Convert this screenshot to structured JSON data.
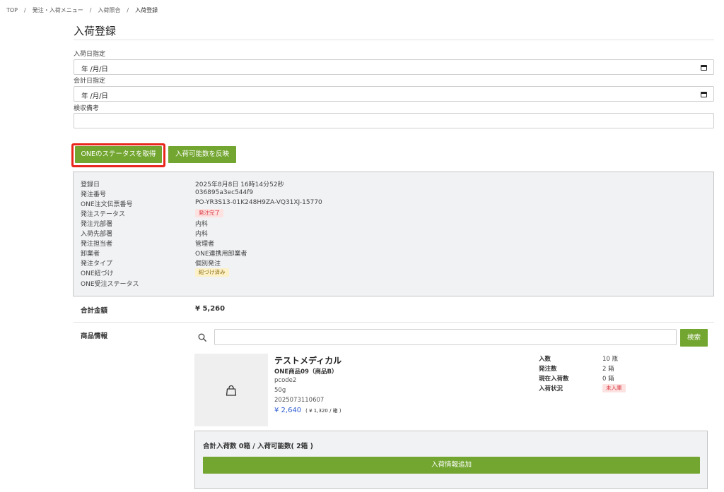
{
  "breadcrumb": {
    "items": [
      "TOP",
      "発注・入荷メニュー",
      "入荷照合"
    ],
    "current": "入荷登録",
    "separator": "/"
  },
  "page": {
    "title": "入荷登録"
  },
  "form": {
    "arrival_date_label": "入荷日指定",
    "arrival_date_value": "年 /月/日",
    "accounting_date_label": "会計日指定",
    "accounting_date_value": "年 /月/日",
    "inspection_note_label": "検収備考",
    "inspection_note_value": ""
  },
  "actions": {
    "get_one_status_label": "ONEのステータスを取得",
    "reflect_available_label": "入荷可能数を反映"
  },
  "info": {
    "registered_date_label": "登録日",
    "registered_date_value": "2025年8月8日 16時14分52秒",
    "order_number_label": "発注番号",
    "order_number_value": "036895a3ec544f9",
    "one_slip_label": "ONE注文伝票番号",
    "one_slip_value": "PO-YR3S13-01K248H9ZA-VQ31XJ-15770",
    "order_status_label": "発注ステータス",
    "order_status_value": "発注完了",
    "source_dept_label": "発注元部署",
    "source_dept_value": "内科",
    "dest_dept_label": "入荷先部署",
    "dest_dept_value": "内科",
    "person_label": "発注担当者",
    "person_value": "管理者",
    "wholesaler_label": "卸業者",
    "wholesaler_value": "ONE連携用卸業者",
    "order_type_label": "発注タイプ",
    "order_type_value": "個別発注",
    "one_link_label": "ONE紐づけ",
    "one_link_value": "紐づけ済み",
    "one_order_status_label": "ONE受注ステータス",
    "one_order_status_value": ""
  },
  "summary": {
    "total_label": "合計金額",
    "total_value": "¥ 5,260"
  },
  "products": {
    "section_label": "商品情報",
    "search_placeholder": "",
    "search_button_label": "検索",
    "item": {
      "name": "テストメディカル",
      "subname": "ONE商品09（商品B）",
      "code": "pcode2",
      "size": "50g",
      "jan": "2025073110607",
      "price": "¥ 2,640",
      "unit_price": "( ¥ 1,320 / 箱 )",
      "stats": {
        "qty_per_label": "入数",
        "qty_per_value": "10 瓶",
        "ordered_label": "発注数",
        "ordered_value": "2 箱",
        "current_label": "現在入荷数",
        "current_value": "0 箱",
        "status_label": "入荷状況",
        "status_value": "未入庫"
      }
    },
    "arrival_summary": "合計入荷数 0箱 / 入荷可能数( 2箱 )",
    "add_button_label": "入荷情報追加"
  },
  "colors": {
    "accent_green": "#72a630",
    "highlight_red": "#e8261c",
    "price_blue": "#2d5cd0"
  }
}
